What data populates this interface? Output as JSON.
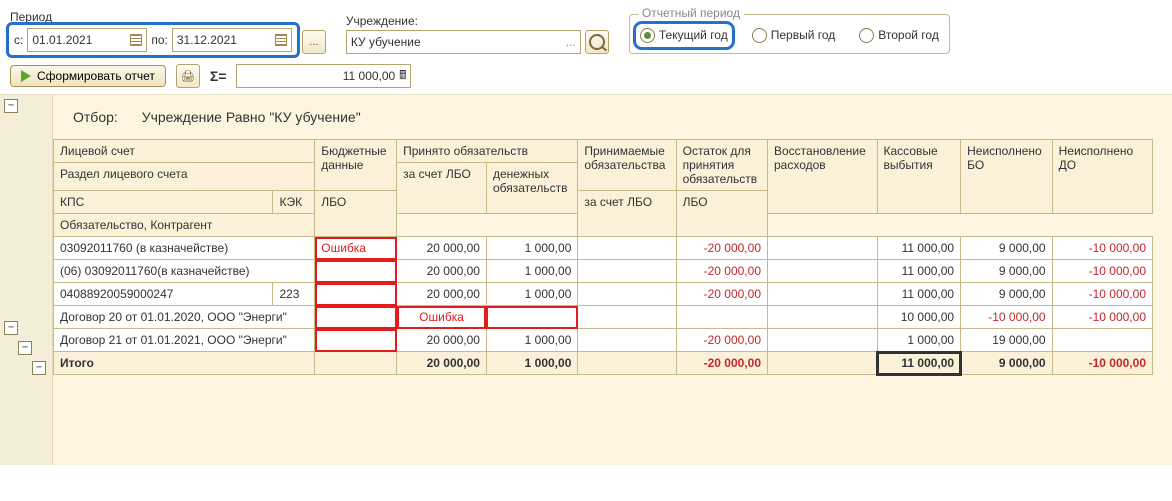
{
  "labels": {
    "period": "Период",
    "from": "с:",
    "to": "по:",
    "org": "Учреждение:",
    "rep_period": "Отчетный период",
    "current_year": "Текущий год",
    "first_year": "Первый год",
    "second_year": "Второй год",
    "run": "Сформировать отчет",
    "sigma": "Σ=",
    "filter_key": "Отбор:",
    "filter_val": "Учреждение Равно \"КУ убучение\"",
    "dots": "...",
    "total": "Итого"
  },
  "values": {
    "date_from": "01.01.2021",
    "date_to": "31.12.2021",
    "org": "КУ убучение",
    "sum": "11 000,00"
  },
  "headers": {
    "c0": "Лицевой счет",
    "c1": "Бюджетные данные",
    "c2": "Принято обязательств",
    "c3": "Принимаемые обязательства",
    "c4": "Остаток для принятия обязательств",
    "c5": "Восстановление расходов",
    "c6": "Кассовые выбытия",
    "c7": "Неисполнено БО",
    "c8": "Неисполнено ДО",
    "r1c0": "Раздел лицевого счета",
    "r2c0a": "КПС",
    "r2c0b": "КЭК",
    "r3c0": "Обязательство, Контрагент",
    "lbo": "ЛБО",
    "za_lbo": "за счет ЛБО",
    "den_ob": "денежных обязательств"
  },
  "err": "Ошибка",
  "rows": [
    {
      "indent": "pad10",
      "c0": "03092011760 (в казначействе)",
      "err_lbo": true,
      "v_lbo": "20 000,00",
      "v_den": "1 000,00",
      "v_prin": "",
      "v_ost": "-20 000,00",
      "v_voss": "",
      "v_kass": "11 000,00",
      "v_bo": "9 000,00",
      "v_do": "-10 000,00"
    },
    {
      "indent": "pad20",
      "c0": "(06) 03092011760(в казначействе)",
      "err_lbo": true,
      "v_lbo": "20 000,00",
      "v_den": "1 000,00",
      "v_prin": "",
      "v_ost": "-20 000,00",
      "v_voss": "",
      "v_kass": "11 000,00",
      "v_bo": "9 000,00",
      "v_do": "-10 000,00"
    },
    {
      "indent": "pad30",
      "c0": "04088920059000247",
      "kek": "223",
      "err_lbo": true,
      "v_lbo": "20 000,00",
      "v_den": "1 000,00",
      "v_prin": "",
      "v_ost": "-20 000,00",
      "v_voss": "",
      "v_kass": "11 000,00",
      "v_bo": "9 000,00",
      "v_do": "-10 000,00"
    },
    {
      "indent": "pad40",
      "c0": "Договор 20 от 01.01.2020, ООО \"Энерги\"",
      "err_lbo": true,
      "err_prin": true,
      "err_den": true,
      "v_lbo": "",
      "v_den": "",
      "v_prin": "",
      "v_ost": "",
      "v_voss": "",
      "v_kass": "10 000,00",
      "v_bo": "-10 000,00",
      "v_do": "-10 000,00"
    },
    {
      "indent": "pad40",
      "c0": "Договор 21 от 01.01.2021, ООО \"Энерги\"",
      "err_lbo": true,
      "v_lbo": "20 000,00",
      "v_den": "1 000,00",
      "v_prin": "",
      "v_ost": "-20 000,00",
      "v_voss": "",
      "v_kass": "1 000,00",
      "v_bo": "19 000,00",
      "v_do": ""
    }
  ],
  "total": {
    "v_lbo": "20 000,00",
    "v_den": "1 000,00",
    "v_prin": "",
    "v_ost": "-20 000,00",
    "v_voss": "",
    "v_kass": "11 000,00",
    "v_bo": "9 000,00",
    "v_do": "-10 000,00"
  }
}
